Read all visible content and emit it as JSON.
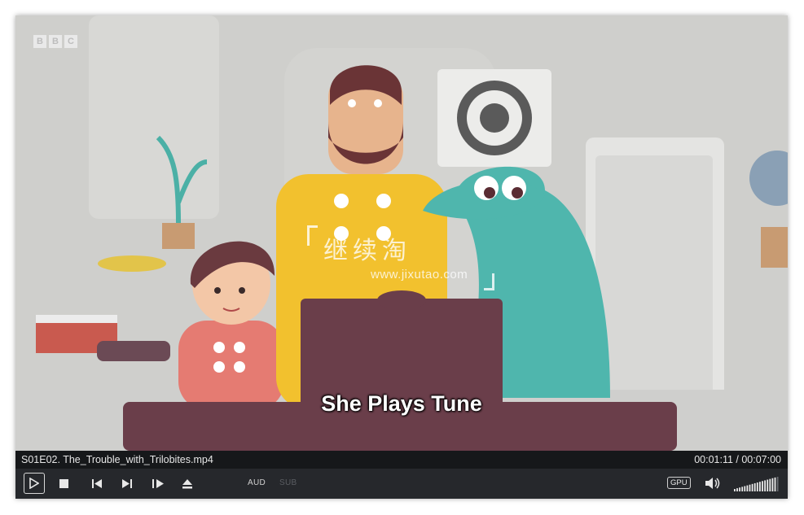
{
  "watermark": {
    "brand_cn": "继续淘",
    "url": "www.jixutao.com"
  },
  "broadcaster_logo": [
    "B",
    "B",
    "C"
  ],
  "subtitle": "She Plays Tune",
  "file": {
    "name": "S01E02. The_Trouble_with_Trilobites.mp4",
    "time": "00:01:11 / 00:07:00"
  },
  "controls": {
    "audio_label": "AUD",
    "subtitle_label": "SUB",
    "gpu_label": "GPU",
    "volume_level": 0.9
  },
  "icons": [
    "play-icon",
    "stop-icon",
    "previous-icon",
    "next-icon",
    "frame-step-icon",
    "eject-icon",
    "speaker-icon"
  ]
}
